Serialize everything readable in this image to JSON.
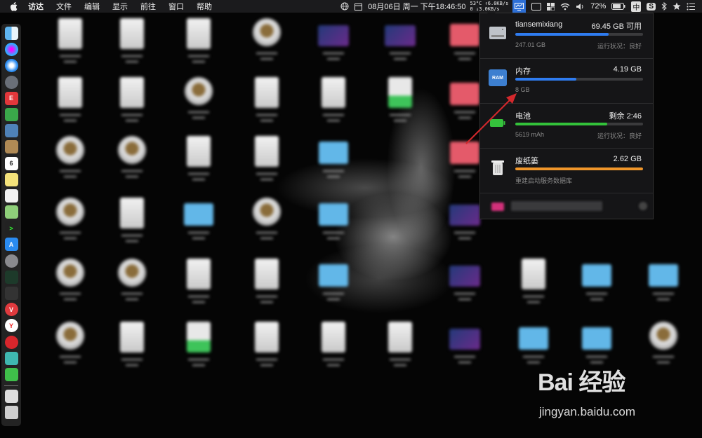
{
  "menubar": {
    "items": [
      "访达",
      "文件",
      "编辑",
      "显示",
      "前往",
      "窗口",
      "帮助"
    ],
    "datetime": "08月06日 周一 下午18:46:50",
    "temp": "53°C",
    "net_up": "↑6.0KB/s",
    "net_down": "0 ↓3.0KB/s",
    "battery": "72%",
    "input_method": "中",
    "sougou": "S"
  },
  "panel": {
    "disk": {
      "name": "tiansemixiang",
      "value": "69.45 GB 可用",
      "total": "247.01 GB",
      "status": "运行状况：良好",
      "fill": 0.73,
      "color": "#2f7cf0"
    },
    "memory": {
      "name": "内存",
      "value": "4.19 GB",
      "sub": "8 GB",
      "fill": 0.48,
      "color": "#2f7cf0",
      "icon_text": "RAM"
    },
    "battery": {
      "name": "电池",
      "value": "剩余 2:46",
      "capacity": "5619 mAh",
      "status": "运行状况：良好",
      "fill": 0.72,
      "color": "#33c23a"
    },
    "trash": {
      "name": "废纸篓",
      "value": "2.62 GB",
      "sub": "重建启动服务数据库",
      "fill": 1.0,
      "color": "#f0962a"
    }
  },
  "watermark": {
    "brand": "Bai 经验",
    "url": "jingyan.baidu.com"
  },
  "colors": {
    "accent": "#2d6fd6",
    "panel_bg": "#161618"
  }
}
